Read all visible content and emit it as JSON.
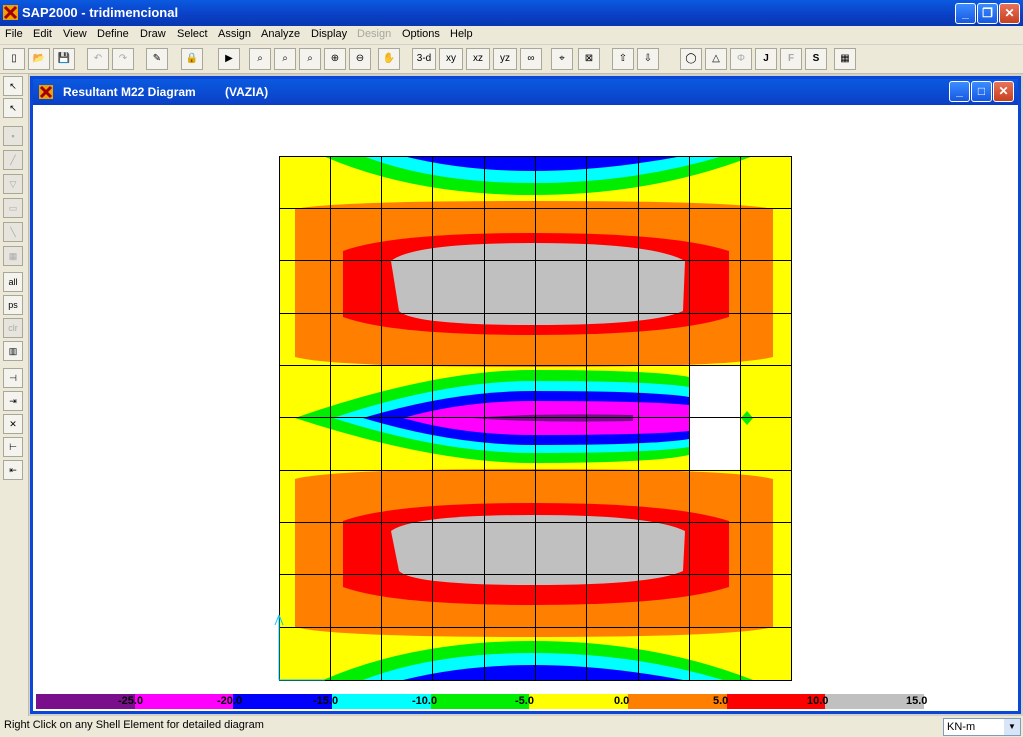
{
  "app": {
    "title": "SAP2000 - tridimencional"
  },
  "menu": [
    "File",
    "Edit",
    "View",
    "Define",
    "Draw",
    "Select",
    "Assign",
    "Analyze",
    "Display",
    "Design",
    "Options",
    "Help"
  ],
  "menu_disabled": [
    "Design"
  ],
  "toolbar": {
    "view_3d": "3-d",
    "view_xy": "xy",
    "view_xz": "xz",
    "view_yz": "yz"
  },
  "left_tools": {
    "all": "all",
    "ps": "ps",
    "clr": "clr"
  },
  "diagram_window": {
    "title": "Resultant M22 Diagram",
    "case": "(VAZIA)"
  },
  "scale": {
    "labels": [
      "-25.0",
      "-20.0",
      "-15.0",
      "-10.0",
      "-5.0",
      "0.0",
      "5.0",
      "10.0",
      "15.0"
    ],
    "colors": [
      "#7a0f8c",
      "#ff00ff",
      "#0000ff",
      "#00ffff",
      "#00ee00",
      "#ffff00",
      "#ff8000",
      "#ff0000",
      "#c0c0c0"
    ]
  },
  "status": {
    "text": "Right Click on any Shell Element for detailed diagram",
    "units": "KN-m"
  }
}
